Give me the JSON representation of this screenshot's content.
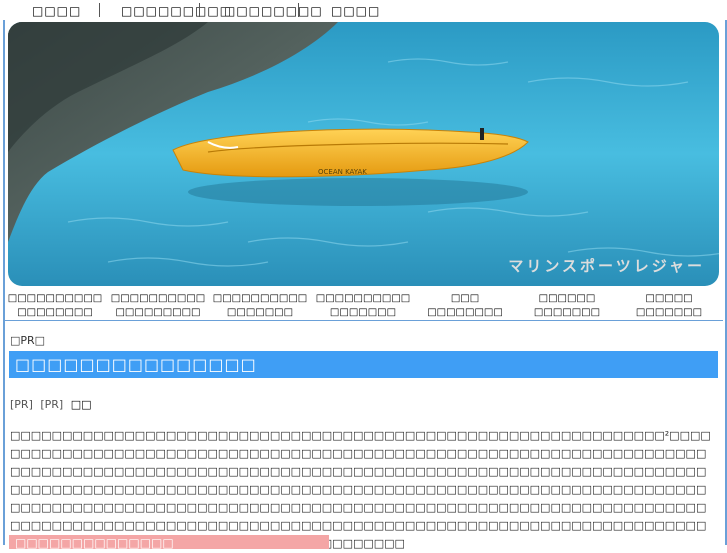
{
  "top_nav": {
    "items": [
      "□□□□",
      "□□□□□□□□□",
      "□□□□□□□□",
      "□□□□"
    ]
  },
  "banner": {
    "caption": "マリンスポーツレジャー",
    "kayak_text": "OCEAN KAYAK"
  },
  "sub_nav": {
    "items": [
      {
        "line1": "□□□□□□□□□□",
        "line2": "□□□□□□□□"
      },
      {
        "line1": "□□□□□□□□□□",
        "line2": "□□□□□□□□□"
      },
      {
        "line1": "□□□□□□□□□□",
        "line2": "□□□□□□□"
      },
      {
        "line1": "□□□□□□□□□□",
        "line2": "□□□□□□□"
      },
      {
        "line1": "□□□",
        "line2": "□□□□□□□□"
      },
      {
        "line1": "□□□□□□",
        "line2": "□□□□□□□"
      },
      {
        "line1": "□□□□□",
        "line2": "□□□□□□□"
      }
    ]
  },
  "content": {
    "pr_top": "□PR□",
    "page_title": "□□□□□□□□□□□□□□□",
    "pr_link_1": "[PR]",
    "pr_link_2": "[PR]",
    "pr_tail": "□□",
    "paragraph": "□□□□□□□□□□□□□□□□□□□□□□□□□□□□□□□□□□□□□□□□□□□□□□□□□□□□□□□□□□□□□□□²□□□□□□□□□□□□□□□□□□□□□□□□□□□□□□□□□□□□□□□□□□□□□□□□□□□□□□□□□□□□□□□□□□□□□□□□□□□□□□□□□□□□□□□□□□□□□□□□□□□□□□□□□□□□□□□□□□□□□□□□□□□□□□□□□□□□□□□□□□□□□□□□□□□□□□□□□□□□□□□□□□□□□□□□□□□□□□□□□□□□□□□□□□□□□□□□□□□□□□□□□□□□□□□□□□□□□□□□□□□□□□□□□□□□□□□□□□□□□□□□□□□□□□□□□□□□□□□□□□□□□□□□□□□□□□□□□□□□□□□□□□□□□□□□□□□□□□□□□□□□□□□□□□□□□□□□□□□□□□□□□□□□□□□□□□□□□□□□□□□□□□□□□□□□□□□□□□□□□□□□□□□□□□□□□□□□□□□□□",
    "section_title": "□□□□□□□□□□□□□□"
  },
  "colors": {
    "title_bar": "#3f9ef5",
    "section_bar": "#f4a6a6",
    "frame_border": "#6aa0d8",
    "kayak": "#f6b820",
    "water": "#3aaed0"
  }
}
